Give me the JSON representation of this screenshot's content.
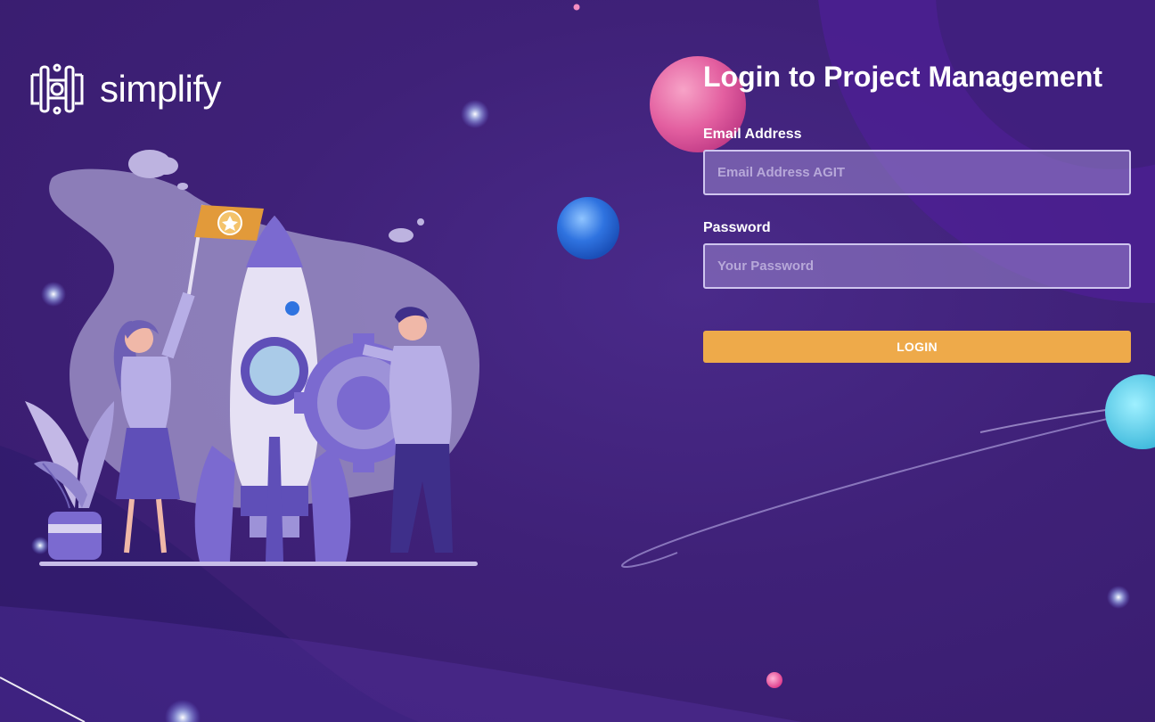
{
  "brand": {
    "name": "simplify",
    "logo_icon": "simplify-logo-icon"
  },
  "login": {
    "title": "Login to Project Management",
    "email": {
      "label": "Email Address",
      "placeholder": "Email Address AGIT",
      "value": ""
    },
    "password": {
      "label": "Password",
      "placeholder": "Your Password",
      "value": ""
    },
    "submit_label": "LOGIN"
  },
  "colors": {
    "background": "#3f2178",
    "accent_button": "#eeaa4a",
    "input_background": "#8a72c4",
    "input_border": "#cfc5ef",
    "flag": "#e29a3a"
  },
  "illustration": {
    "icons": [
      "rocket-icon",
      "flag-icon",
      "gear-icon",
      "plant-icon",
      "woman-figure",
      "man-figure"
    ]
  }
}
